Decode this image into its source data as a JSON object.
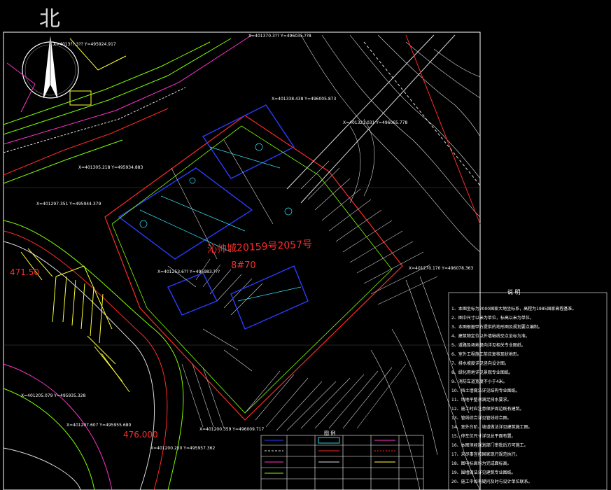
{
  "north": {
    "label": "北"
  },
  "plan": {
    "title_line1": "沁帅城20159号2057号",
    "title_line2": "8#70",
    "level_left": "471.50",
    "level_bottom": "476.000"
  },
  "coordinates": [
    "X=4013??.3??  Y=495924.917",
    "X=401370.3??  Y=496035.??8",
    "X=401338.438  Y=496005.873",
    "X=401321.031  Y=496065.778",
    "X=401305.218  Y=495934.883",
    "X=401297.351  Y=495944.379",
    "X=401270.170  Y=496078.363",
    "X=401253.6??  Y=495983.???",
    "X=401205.079  Y=495935.328",
    "X=401207.607  Y=495955.680",
    "X=401200.359  Y=496009.717",
    "X=401200.250  Y=495957.362"
  ],
  "legend": {
    "title": "图   例"
  },
  "notes": {
    "title": "说 明",
    "items": [
      "1、本图坐标为2000国家大地坐标系，高程为1985国家高程基准。",
      "2、图中尺寸以米为单位，标高以米为单位。",
      "3、本图根据甲方提供的地形图及规划要点编制。",
      "4、建筑物定位以外墙轴线交点坐标为准。",
      "5、道路及场地竖向详见相关专业图纸。",
      "6、室外工程施工前应复核现状地形。",
      "7、排水坡度详见竖向设计图。",
      "8、绿化用地详见景观专业图纸。",
      "9、消防车道宽度不小于4米。",
      "10、挡土墙做法详见结构专业图纸。",
      "11、场地平整须满足排水要求。",
      "12、施工时应注意保护周边既有建筑。",
      "13、管线综合详见管线综合图。",
      "14、室外台阶、坡道做法详见建筑施工图。",
      "15、停车位尺寸详见总平面布置。",
      "16、本图须经规划部门审批后方可施工。",
      "17、未尽事宜按国家现行规范执行。",
      "18、图中标高均为完成面标高。",
      "19、围墙做法详见建筑专业图纸。",
      "20、施工中如有疑问及时与设计单位联系。"
    ]
  },
  "colors": {
    "background": "#000000",
    "frame": "#ffffff",
    "site_boundary": "#ff2a2a",
    "road": "#7fff00",
    "building": "#2a3cff",
    "hatch": "#c8c8c8",
    "contour": "#dcdcdc",
    "magenta": "#ff33cc",
    "yellow": "#ffff33",
    "cyan": "#33e6ff"
  }
}
